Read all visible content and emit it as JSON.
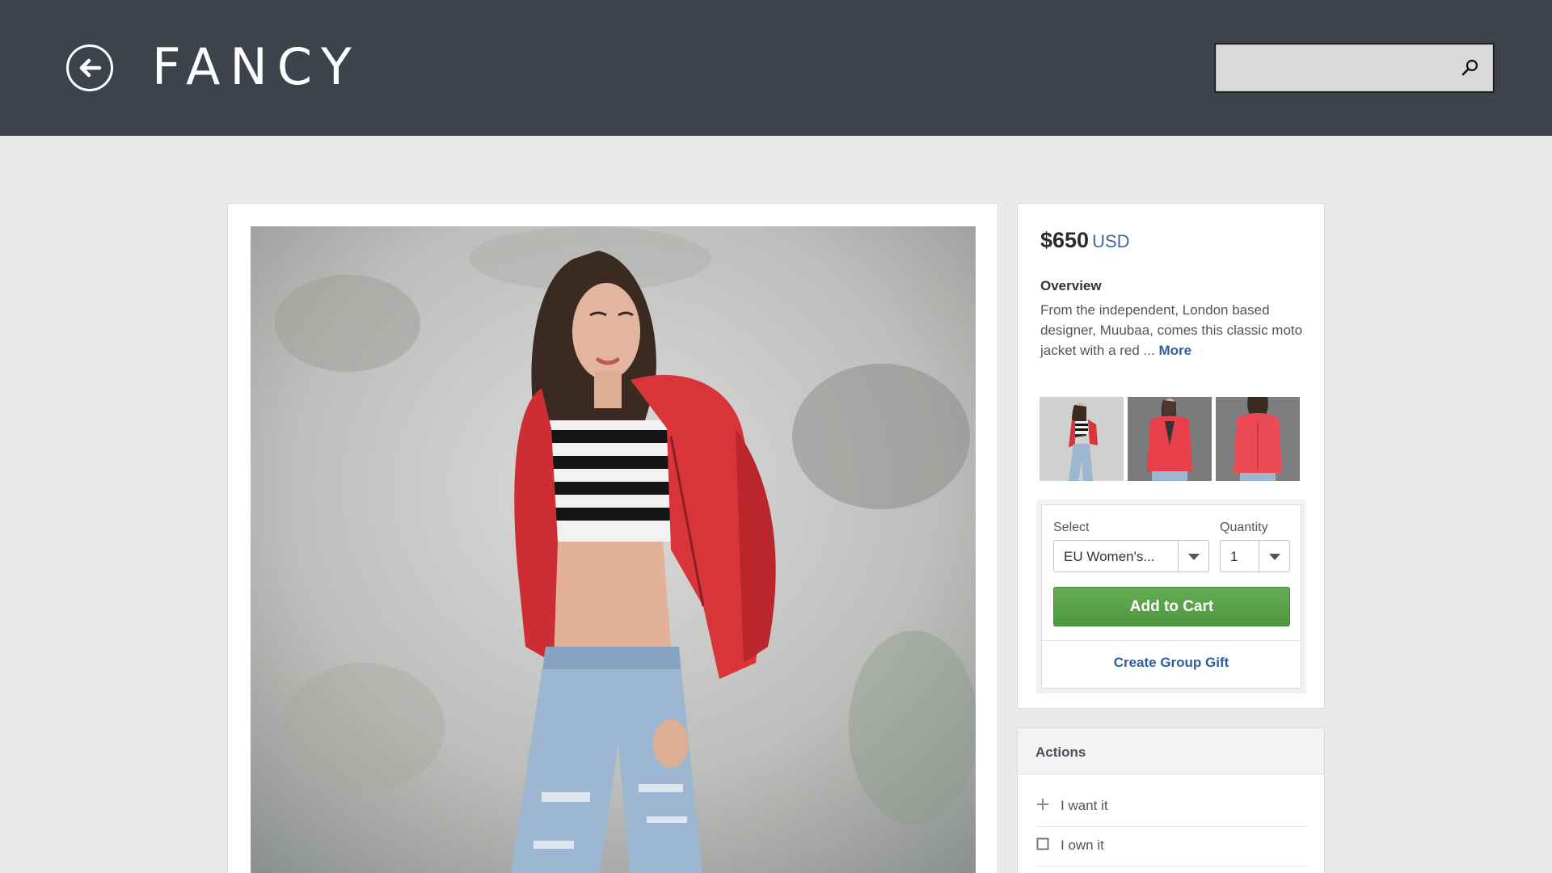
{
  "header": {
    "logo_text": "FANCY",
    "search": {
      "placeholder": "",
      "value": ""
    }
  },
  "product": {
    "price": "$650",
    "currency": "USD",
    "overview_title": "Overview",
    "overview_text": "From the independent, London based designer, Muubaa, comes this classic moto jacket with a red ... ",
    "more_label": "More",
    "thumbnails": [
      "thumbnail-1",
      "thumbnail-2",
      "thumbnail-3"
    ]
  },
  "purchase": {
    "select_label": "Select",
    "select_value": "EU Women's...",
    "quantity_label": "Quantity",
    "quantity_value": "1",
    "add_to_cart_label": "Add to Cart",
    "group_gift_label": "Create Group Gift"
  },
  "actions": {
    "title": "Actions",
    "items": [
      {
        "icon": "plus-icon",
        "label": "I want it"
      },
      {
        "icon": "checkbox-icon",
        "label": "I own it"
      }
    ]
  },
  "colors": {
    "header_bg": "#3e434b",
    "accent_blue": "#2f5f99",
    "cart_green": "#5aa24a",
    "jacket_red": "#d8343a"
  }
}
